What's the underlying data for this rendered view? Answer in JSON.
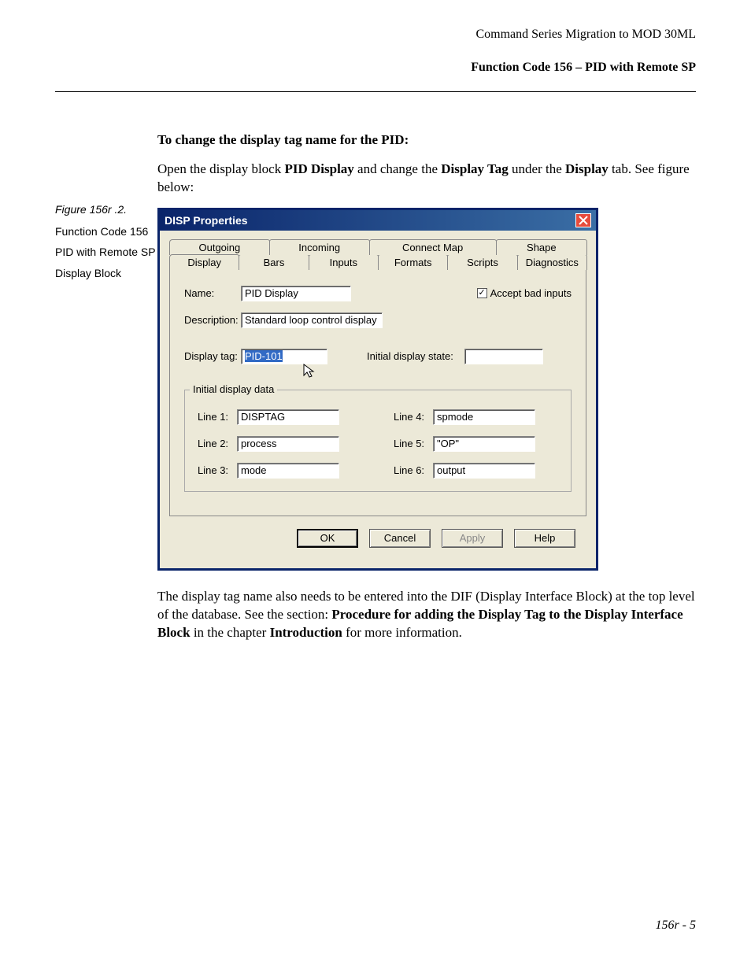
{
  "header": {
    "line1": "Command Series Migration to MOD 30ML",
    "line2": "Function Code 156 – PID with Remote SP"
  },
  "intro": {
    "heading": "To change the display tag name for the PID:",
    "text_pre": "Open the display block ",
    "b1": "PID Display",
    "mid1": " and change the ",
    "b2": "Display Tag",
    "mid2": " under the ",
    "b3": "Display",
    "mid3": " tab. See figure below:"
  },
  "side": {
    "figure": "Figure 156r .2.",
    "cap1": "Function Code 156",
    "cap2": "PID with Remote SP",
    "cap3": "Display Block"
  },
  "dialog": {
    "title": "DISP Properties",
    "tabs_back": [
      "Outgoing",
      "Incoming",
      "Connect Map",
      "Shape"
    ],
    "tabs_front": [
      "Display",
      "Bars",
      "Inputs",
      "Formats",
      "Scripts",
      "Diagnostics"
    ],
    "labels": {
      "name": "Name:",
      "description": "Description:",
      "displaytag": "Display tag:",
      "initialstate": "Initial display state:",
      "accept": "Accept bad inputs",
      "groupbox": "Initial display data",
      "line1": "Line 1:",
      "line2": "Line 2:",
      "line3": "Line 3:",
      "line4": "Line 4:",
      "line5": "Line 5:",
      "line6": "Line 6:"
    },
    "values": {
      "name": "PID Display",
      "description": "Standard loop control display",
      "displaytag": "PID-101",
      "initialstate": "",
      "accept_checked": true,
      "line1": "DISPTAG",
      "line2": "process",
      "line3": "mode",
      "line4": "spmode",
      "line5": "\"OP\"",
      "line6": "output"
    },
    "buttons": {
      "ok": "OK",
      "cancel": "Cancel",
      "apply": "Apply",
      "help": "Help"
    }
  },
  "after": {
    "t1": "The display tag name also needs to be entered into the DIF (Display Interface Block) at the top level of the database. See the section: ",
    "b1": "Procedure for adding the Display Tag to the Display Interface Block",
    "t2": " in the chapter ",
    "b2": "Introduction",
    "t3": " for more information."
  },
  "footer": "156r - 5"
}
